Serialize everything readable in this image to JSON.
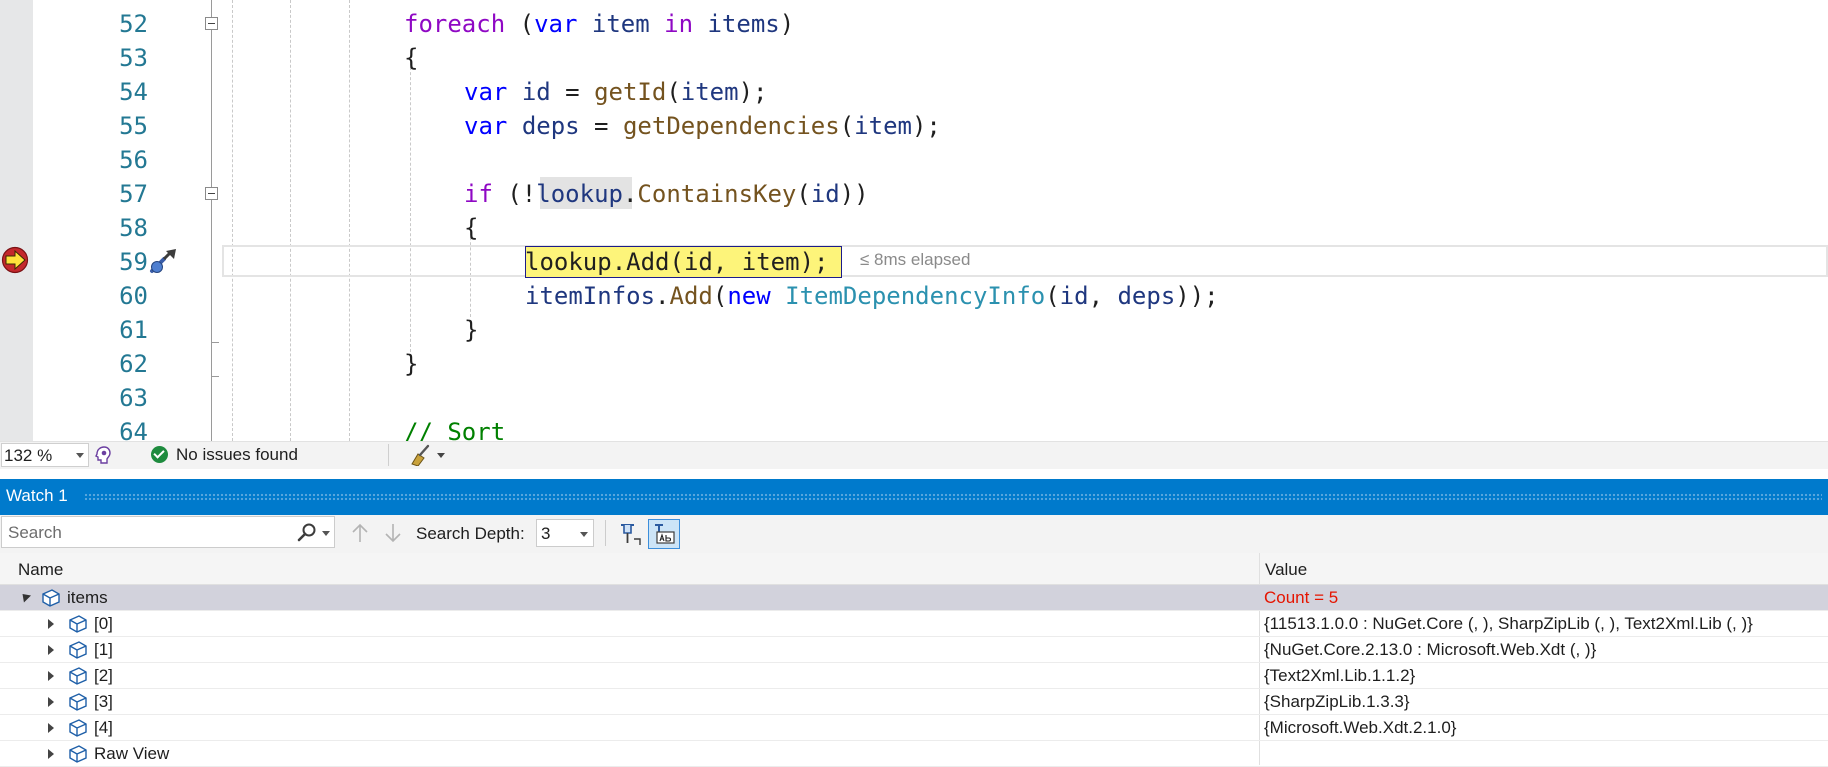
{
  "editor": {
    "line_numbers": [
      "52",
      "53",
      "54",
      "55",
      "56",
      "57",
      "58",
      "59",
      "60",
      "61",
      "62",
      "63",
      "64"
    ],
    "elapsed_hint": "≤ 8ms elapsed"
  },
  "code": {
    "l52": {
      "foreach": "foreach",
      "open": " (",
      "var": "var",
      "item": "item",
      "in": "in",
      "items": "items",
      "close": ")"
    },
    "l53": {
      "brace": "{"
    },
    "l54": {
      "var": "var",
      "id": "id",
      "eq": " = ",
      "fn": "getId",
      "open": "(",
      "arg": "item",
      "close": ");"
    },
    "l55": {
      "var": "var",
      "deps": "deps",
      "eq": " = ",
      "fn": "getDependencies",
      "open": "(",
      "arg": "item",
      "close": ");"
    },
    "l57": {
      "if": "if",
      "open": " (!",
      "obj": "lookup",
      "dot": ".",
      "fn": "ContainsKey",
      "p": "(",
      "arg": "id",
      "close": "))"
    },
    "l58": {
      "brace": "{"
    },
    "l59": {
      "obj": "lookup",
      "dot": ".",
      "fn": "Add",
      "p": "(",
      "a1": "id",
      "comma": ", ",
      "a2": "item",
      "close": ");"
    },
    "l60": {
      "obj": "itemInfos",
      "dot": ".",
      "fn": "Add",
      "p": "(",
      "new": "new",
      "type": "ItemDependencyInfo",
      "p2": "(",
      "a1": "id",
      "comma": ", ",
      "a2": "deps",
      "close": "));"
    },
    "l61": {
      "brace": "}"
    },
    "l62": {
      "brace": "}"
    },
    "l64": {
      "comment": "// Sort"
    }
  },
  "status": {
    "zoom": "132 %",
    "issues": "No issues found"
  },
  "watch": {
    "title": "Watch 1",
    "search_placeholder": "Search",
    "search_depth_label": "Search Depth:",
    "search_depth_value": "3",
    "col_name": "Name",
    "col_value": "Value",
    "rows": [
      {
        "name": "items",
        "value": "Count = 5"
      },
      {
        "name": "[0]",
        "value": "{11513.1.0.0 : NuGet.Core (, ), SharpZipLib (, ), Text2Xml.Lib (, )}"
      },
      {
        "name": "[1]",
        "value": "{NuGet.Core.2.13.0 : Microsoft.Web.Xdt (, )}"
      },
      {
        "name": "[2]",
        "value": "{Text2Xml.Lib.1.1.2}"
      },
      {
        "name": "[3]",
        "value": "{SharpZipLib.1.3.3}"
      },
      {
        "name": "[4]",
        "value": "{Microsoft.Web.Xdt.2.1.0}"
      },
      {
        "name": "Raw View",
        "value": ""
      }
    ]
  },
  "colors": {
    "accent": "#007acc",
    "changed_value": "#e51400",
    "current_statement": "#fdf47a"
  }
}
